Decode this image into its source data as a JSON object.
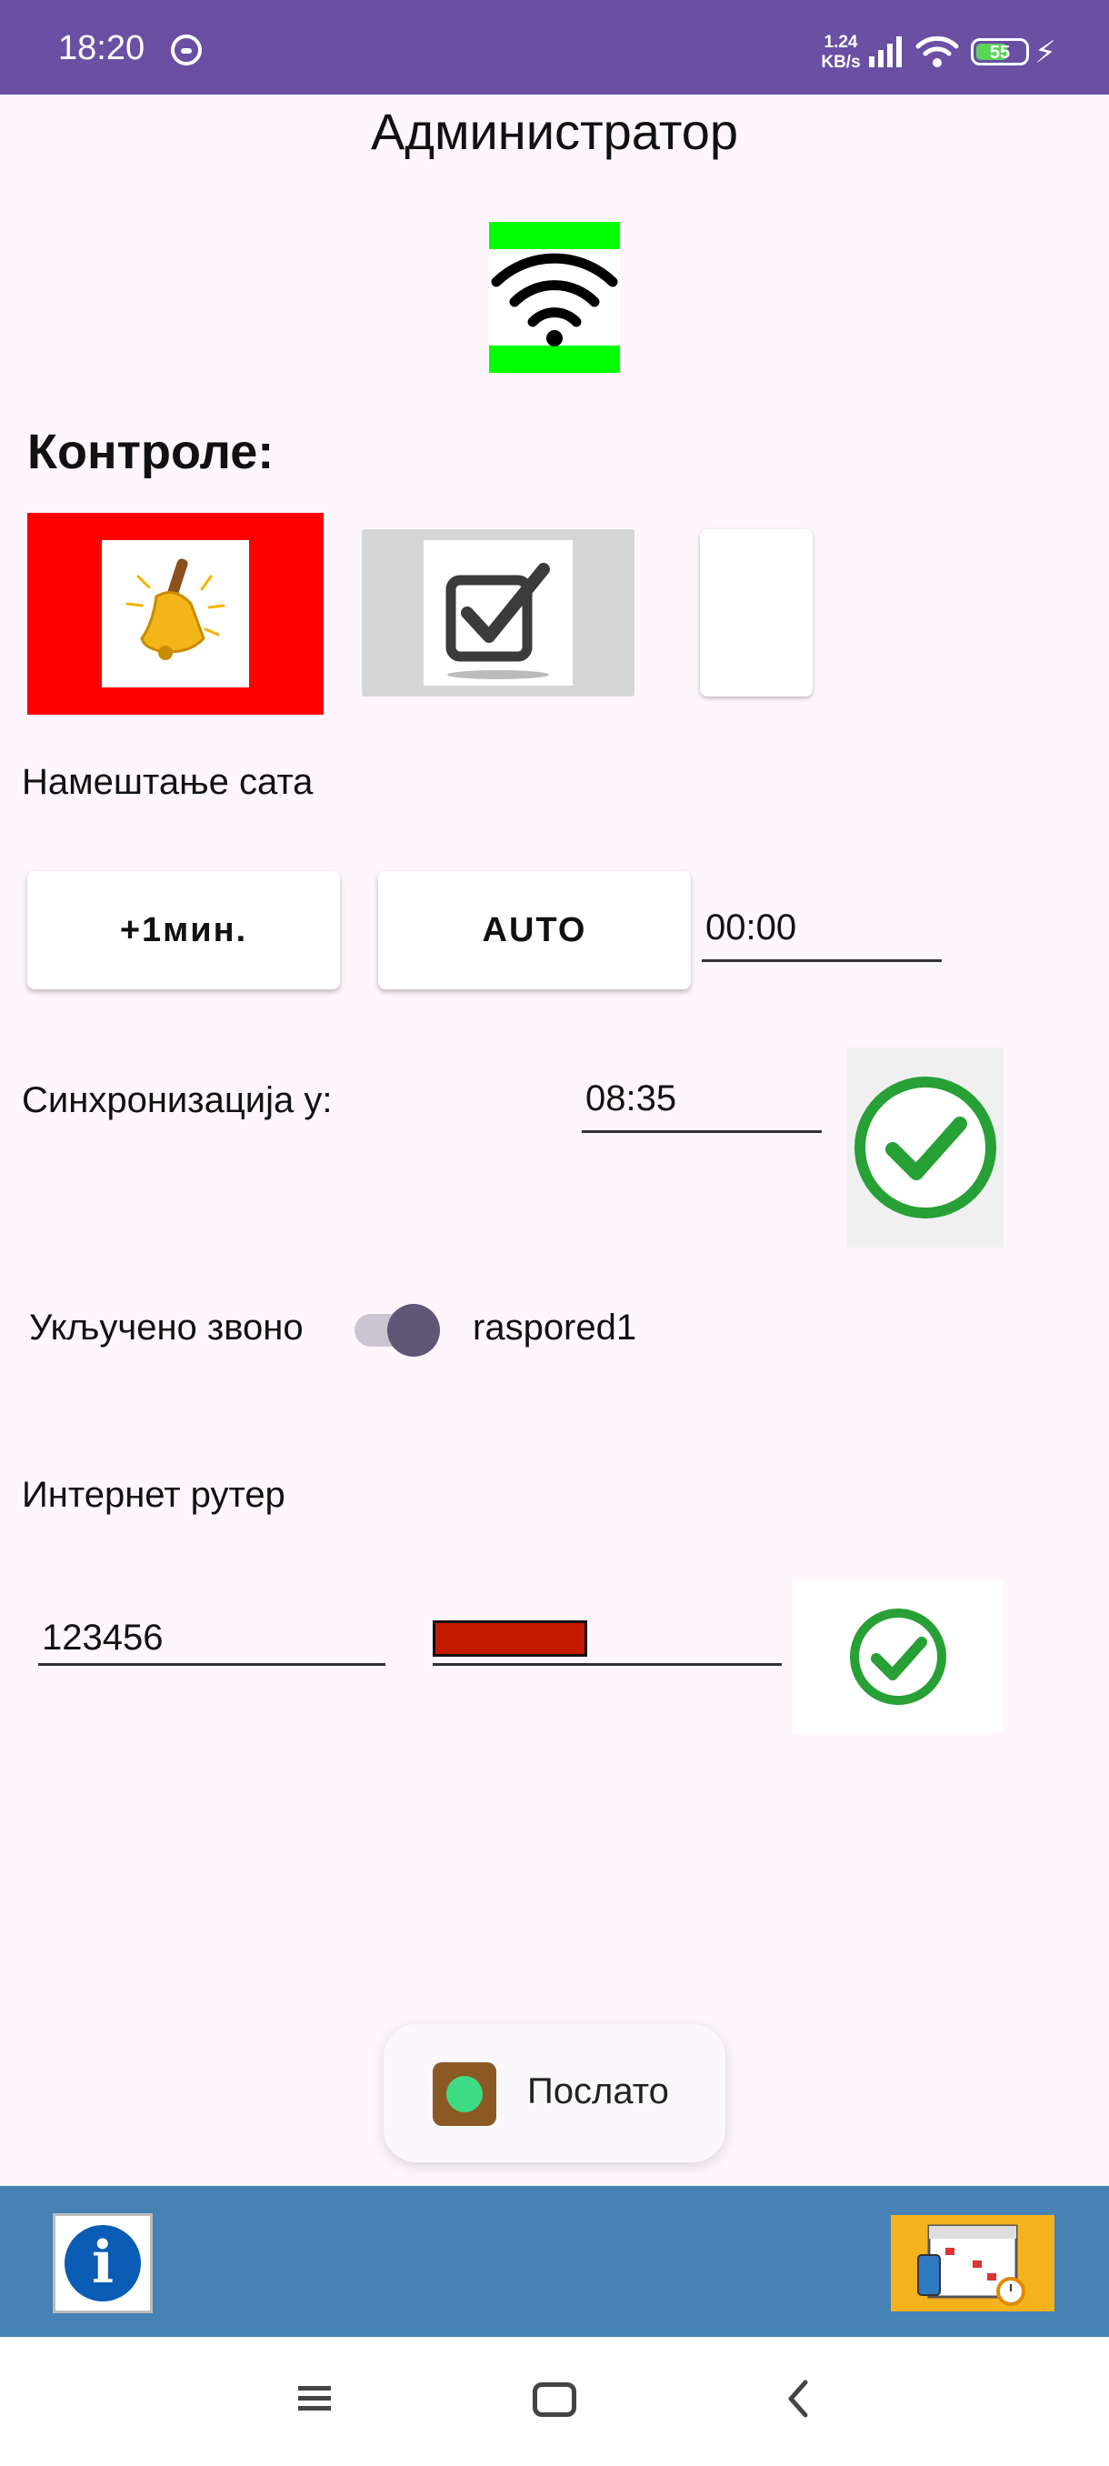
{
  "status_bar": {
    "time": "18:20",
    "net_speed_value": "1.24",
    "net_speed_unit": "KB/s",
    "battery": "55",
    "colors": {
      "background": "#6a4fa3"
    }
  },
  "header": {
    "title": "Администратор"
  },
  "wifi_indicator": {
    "icon": "wifi-icon",
    "color": "#00ff00"
  },
  "controls": {
    "heading": "Контроле:",
    "bell_button": {
      "icon": "bell-icon",
      "color": "#ff0000"
    },
    "check_button": {
      "icon": "checkbox-icon"
    }
  },
  "clock": {
    "label": "Намештање сата",
    "plus_label": "+1мин.",
    "auto_label": "AUTO",
    "time_value": "00:00"
  },
  "sync": {
    "label": "Синхронизација у:",
    "time_value": "08:35",
    "confirm_icon": "check-circle-icon"
  },
  "bell": {
    "label": "Укључено звоно",
    "switch_on": true,
    "schedule_name": "raspored1"
  },
  "router": {
    "label": "Интернет рутер",
    "ssid_value": "123456",
    "password_icon": "masked-password",
    "confirm_icon": "check-circle-icon"
  },
  "toast": {
    "text": "Послато"
  },
  "bottom_bar": {
    "info_icon": "i",
    "schedule_icon": "calendar-clock-icon",
    "color": "#4682b4"
  }
}
